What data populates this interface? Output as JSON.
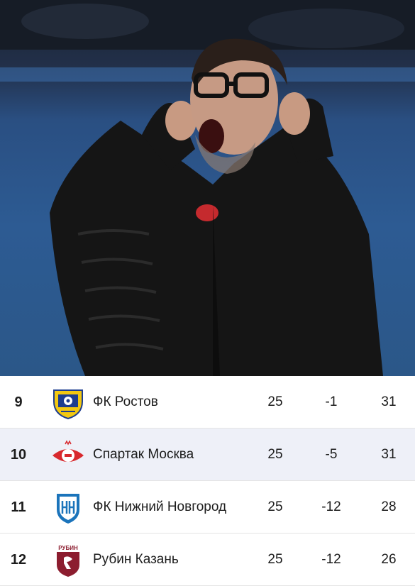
{
  "photo": {
    "alt_subject": "coach-celebrating"
  },
  "standings": {
    "rows": [
      {
        "pos": "9",
        "team": "ФК Ростов",
        "games": "25",
        "diff": "-1",
        "pts": "31",
        "logo": "rostov-logo"
      },
      {
        "pos": "10",
        "team": "Спартак Москва",
        "games": "25",
        "diff": "-5",
        "pts": "31",
        "logo": "spartak-logo",
        "highlight": true
      },
      {
        "pos": "11",
        "team": "ФК Нижний Новгород",
        "games": "25",
        "diff": "-12",
        "pts": "28",
        "logo": "nizhny-logo"
      },
      {
        "pos": "12",
        "team": "Рубин Казань",
        "games": "25",
        "diff": "-12",
        "pts": "26",
        "logo": "rubin-logo",
        "logo_text": "РУБИН"
      }
    ]
  },
  "colors": {
    "highlight_row": "#eef0f8",
    "rostov_yellow": "#f2c811",
    "rostov_blue": "#1d3d8f",
    "spartak_red": "#d8292e",
    "nizhny_blue": "#1b74bb",
    "rubin_maroon": "#8c1d2f"
  }
}
